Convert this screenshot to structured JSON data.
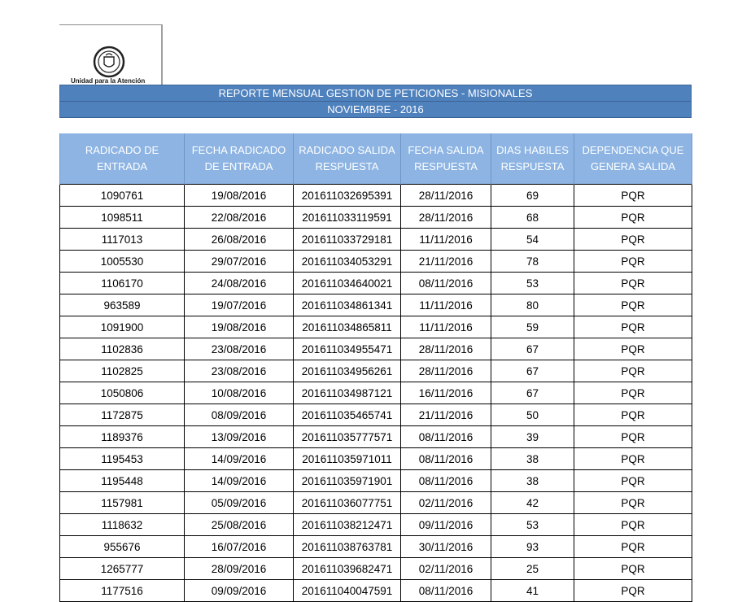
{
  "logo": {
    "text": "Unidad para la Atención"
  },
  "report": {
    "title": "REPORTE MENSUAL GESTION DE PETICIONES - MISIONALES",
    "period": "NOVIEMBRE - 2016"
  },
  "table": {
    "headers": [
      [
        "RADICADO DE",
        "ENTRADA"
      ],
      [
        "FECHA RADICADO",
        "DE ENTRADA"
      ],
      [
        "RADICADO SALIDA",
        "RESPUESTA"
      ],
      [
        "FECHA SALIDA",
        "RESPUESTA"
      ],
      [
        "DIAS HABILES",
        "RESPUESTA"
      ],
      [
        "DEPENDENCIA QUE",
        "GENERA SALIDA"
      ]
    ],
    "rows": [
      [
        "1090761",
        "19/08/2016",
        "201611032695391",
        "28/11/2016",
        "69",
        "PQR"
      ],
      [
        "1098511",
        "22/08/2016",
        "201611033119591",
        "28/11/2016",
        "68",
        "PQR"
      ],
      [
        "1117013",
        "26/08/2016",
        "201611033729181",
        "11/11/2016",
        "54",
        "PQR"
      ],
      [
        "1005530",
        "29/07/2016",
        "201611034053291",
        "21/11/2016",
        "78",
        "PQR"
      ],
      [
        "1106170",
        "24/08/2016",
        "201611034640021",
        "08/11/2016",
        "53",
        "PQR"
      ],
      [
        "963589",
        "19/07/2016",
        "201611034861341",
        "11/11/2016",
        "80",
        "PQR"
      ],
      [
        "1091900",
        "19/08/2016",
        "201611034865811",
        "11/11/2016",
        "59",
        "PQR"
      ],
      [
        "1102836",
        "23/08/2016",
        "201611034955471",
        "28/11/2016",
        "67",
        "PQR"
      ],
      [
        "1102825",
        "23/08/2016",
        "201611034956261",
        "28/11/2016",
        "67",
        "PQR"
      ],
      [
        "1050806",
        "10/08/2016",
        "201611034987121",
        "16/11/2016",
        "67",
        "PQR"
      ],
      [
        "1172875",
        "08/09/2016",
        "201611035465741",
        "21/11/2016",
        "50",
        "PQR"
      ],
      [
        "1189376",
        "13/09/2016",
        "201611035777571",
        "08/11/2016",
        "39",
        "PQR"
      ],
      [
        "1195453",
        "14/09/2016",
        "201611035971011",
        "08/11/2016",
        "38",
        "PQR"
      ],
      [
        "1195448",
        "14/09/2016",
        "201611035971901",
        "08/11/2016",
        "38",
        "PQR"
      ],
      [
        "1157981",
        "05/09/2016",
        "201611036077751",
        "02/11/2016",
        "42",
        "PQR"
      ],
      [
        "1118632",
        "25/08/2016",
        "201611038212471",
        "09/11/2016",
        "53",
        "PQR"
      ],
      [
        "955676",
        "16/07/2016",
        "201611038763781",
        "30/11/2016",
        "93",
        "PQR"
      ],
      [
        "1265777",
        "28/09/2016",
        "201611039682471",
        "02/11/2016",
        "25",
        "PQR"
      ],
      [
        "1177516",
        "09/09/2016",
        "201611040047591",
        "08/11/2016",
        "41",
        "PQR"
      ]
    ]
  }
}
